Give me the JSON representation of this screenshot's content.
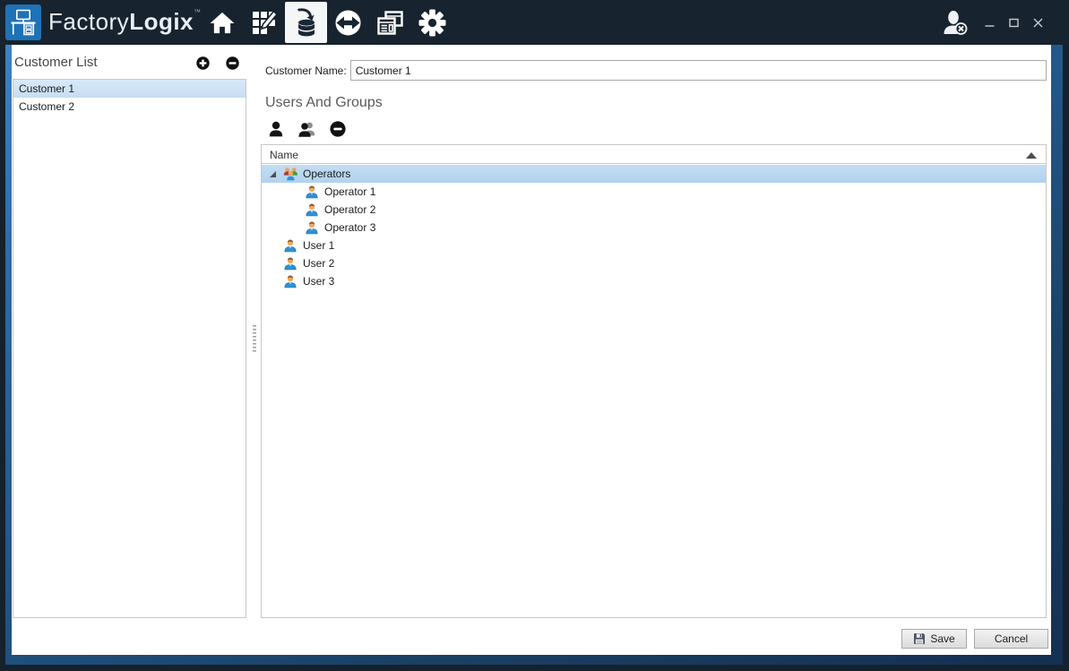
{
  "titlebar": {
    "brand_light": "Factory",
    "brand_bold": "Logix",
    "brand_tm": "™",
    "logo_icon": "factorylogix-desk-logo-icon",
    "nav_icons": [
      {
        "name": "home-icon",
        "selected": false
      },
      {
        "name": "production-edit-icon",
        "selected": false
      },
      {
        "name": "data-import-icon",
        "selected": true
      },
      {
        "name": "transfer-icon",
        "selected": false
      },
      {
        "name": "reports-icon",
        "selected": false
      },
      {
        "name": "settings-gear-icon",
        "selected": false
      }
    ],
    "user_session_icon": "user-logout-icon",
    "window_controls": [
      "minimize-icon",
      "maximize-icon",
      "close-icon"
    ]
  },
  "customer_list": {
    "title": "Customer List",
    "add_icon": "plus-circle-icon",
    "remove_icon": "minus-circle-icon",
    "items": [
      {
        "label": "Customer 1",
        "selected": true
      },
      {
        "label": "Customer 2",
        "selected": false
      }
    ]
  },
  "detail": {
    "customer_name_label": "Customer Name:",
    "customer_name_value": "Customer 1",
    "section_title": "Users And Groups",
    "toolbar_icons": [
      "add-user-icon",
      "add-group-icon",
      "remove-circle-icon"
    ],
    "tree": {
      "column_header": "Name",
      "sort": "ascending",
      "rows": [
        {
          "type": "group",
          "label": "Operators",
          "level": 0,
          "selected": true,
          "expanded": true
        },
        {
          "type": "user",
          "label": "Operator 1",
          "level": 1,
          "selected": false
        },
        {
          "type": "user",
          "label": "Operator 2",
          "level": 1,
          "selected": false
        },
        {
          "type": "user",
          "label": "Operator 3",
          "level": 1,
          "selected": false
        },
        {
          "type": "user",
          "label": "User 1",
          "level": 0,
          "selected": false
        },
        {
          "type": "user",
          "label": "User 2",
          "level": 0,
          "selected": false
        },
        {
          "type": "user",
          "label": "User 3",
          "level": 0,
          "selected": false
        }
      ]
    },
    "save_label": "Save",
    "cancel_label": "Cancel"
  },
  "colors": {
    "topbar_bg": "#17232e",
    "logo_blue": "#1e72b8",
    "frame_blue_top": "#3c82c4",
    "frame_blue_bottom": "#143052",
    "list_selected": "#cfe4f7",
    "tree_selected": "#b8d6f0",
    "box_border": "#c8c8c8",
    "input_border": "#a9a9a9"
  }
}
